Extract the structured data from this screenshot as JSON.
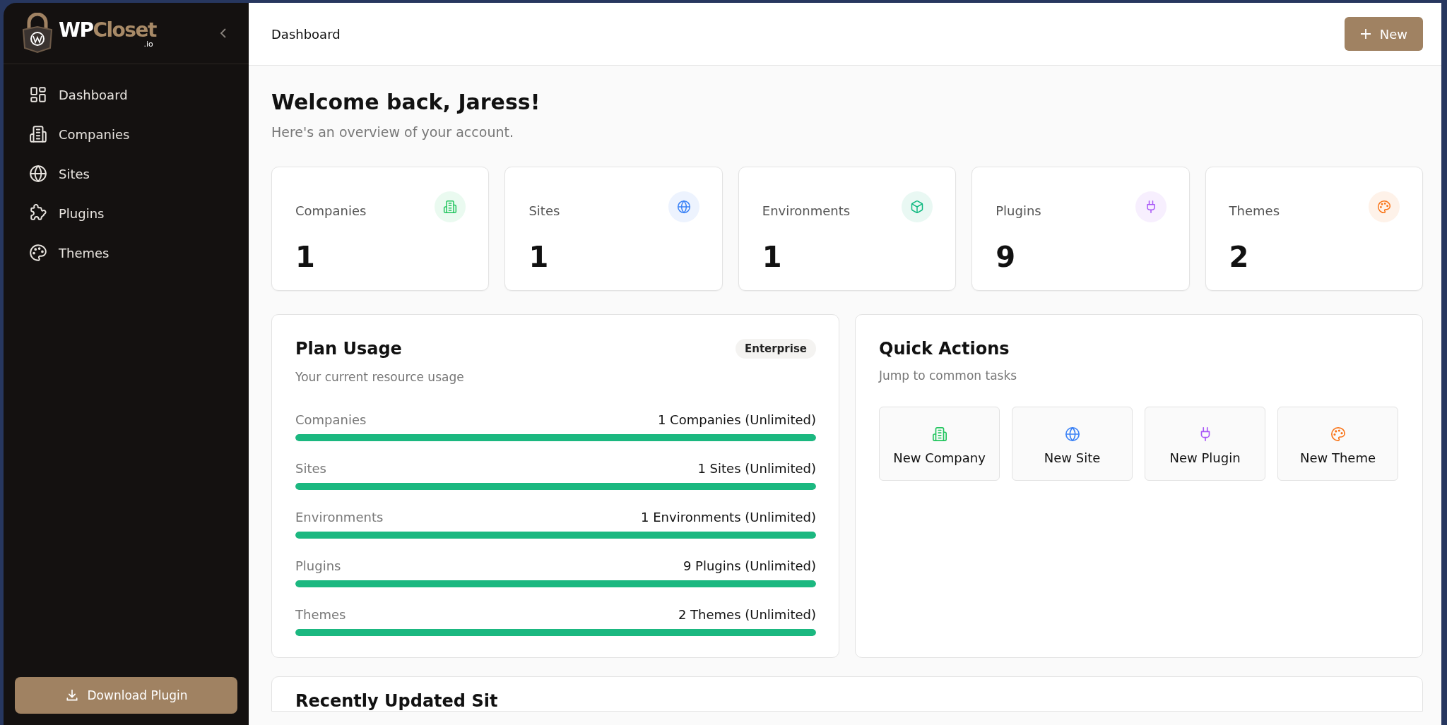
{
  "logo": {
    "brand_light": "WP",
    "brand_accent": "Closet",
    "suffix": ".io"
  },
  "sidebar": {
    "items": [
      {
        "label": "Dashboard",
        "kind": "grid"
      },
      {
        "label": "Companies",
        "kind": "building"
      },
      {
        "label": "Sites",
        "kind": "globe"
      },
      {
        "label": "Plugins",
        "kind": "puzzle"
      },
      {
        "label": "Themes",
        "kind": "palette"
      }
    ],
    "download_button": "Download Plugin"
  },
  "header": {
    "title": "Dashboard",
    "new_button": "New"
  },
  "welcome": {
    "title": "Welcome back, Jaress!",
    "subtitle": "Here's an overview of your account."
  },
  "stats": [
    {
      "label": "Companies",
      "value": "1",
      "kind": "building",
      "color": "#22c55e"
    },
    {
      "label": "Sites",
      "value": "1",
      "kind": "globe",
      "color": "#3b82f6"
    },
    {
      "label": "Environments",
      "value": "1",
      "kind": "cube",
      "color": "#10b981"
    },
    {
      "label": "Plugins",
      "value": "9",
      "kind": "plug",
      "color": "#a855f7"
    },
    {
      "label": "Themes",
      "value": "2",
      "kind": "palette",
      "color": "#f97316"
    }
  ],
  "plan_usage": {
    "title": "Plan Usage",
    "badge": "Enterprise",
    "subtitle": "Your current resource usage",
    "rows": [
      {
        "label": "Companies",
        "reading": "1 Companies (Unlimited)",
        "level": 1
      },
      {
        "label": "Sites",
        "reading": "1 Sites (Unlimited)",
        "level": 1
      },
      {
        "label": "Environments",
        "reading": "1 Environments (Unlimited)",
        "level": 1
      },
      {
        "label": "Plugins",
        "reading": "9 Plugins (Unlimited)",
        "level": 1
      },
      {
        "label": "Themes",
        "reading": "2 Themes (Unlimited)",
        "level": 1
      }
    ]
  },
  "quick_actions": {
    "title": "Quick Actions",
    "subtitle": "Jump to common tasks",
    "actions": [
      {
        "label": "New Company",
        "kind": "building",
        "color": "#22c55e"
      },
      {
        "label": "New Site",
        "kind": "globe",
        "color": "#3b82f6"
      },
      {
        "label": "New Plugin",
        "kind": "plug",
        "color": "#a855f7"
      },
      {
        "label": "New Theme",
        "kind": "palette",
        "color": "#f97316"
      }
    ]
  },
  "recent_sites": {
    "title": "Recently Updated Sit"
  }
}
